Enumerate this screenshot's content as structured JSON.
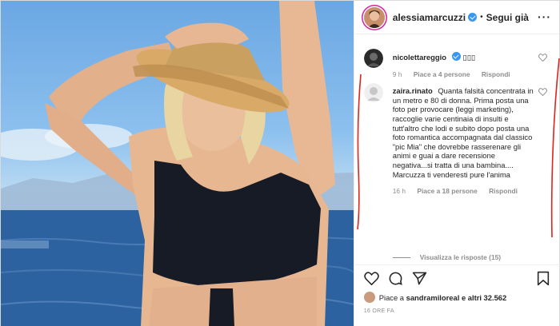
{
  "post": {
    "author": "alessiamarcuzzi",
    "follow_status": "Segui già",
    "separator": "•",
    "more_icon": "more-options-icon"
  },
  "comments": [
    {
      "user": "nicolettareggio",
      "verified": true,
      "text": "▯▯▯",
      "time": "9 h",
      "likes": "Piace a 4 persone",
      "reply": "Rispondi"
    },
    {
      "user": "zaira.rinato",
      "verified": false,
      "text": "Quanta falsità concentrata in un metro e 80 di donna. Prima posta una foto per provocare (leggi marketing), raccoglie varie centinaia di insulti e tutt'altro che lodi e subito dopo posta una foto romantica accompagnata dal classico \"pic Mia\" che dovrebbe rasserenare gli animi e guai a dare recensione negativa...si tratta di una bambina.... Marcuzza ti venderesti pure l'anima",
      "time": "16 h",
      "likes": "Piace a 18 persone",
      "reply": "Rispondi",
      "view_replies": "Visualizza le risposte (15)"
    }
  ],
  "actions": {
    "icons": [
      "heart-icon",
      "comment-icon",
      "share-icon",
      "bookmark-icon"
    ]
  },
  "likes": {
    "prefix": "Piace a",
    "user": "sandramiloreal",
    "suffix": "e altri 32.562"
  },
  "timestamp": "16 ORE FA",
  "colors": {
    "verified": "#3897f0",
    "annotation": "#e0231b",
    "muted": "#8e8e8e"
  }
}
